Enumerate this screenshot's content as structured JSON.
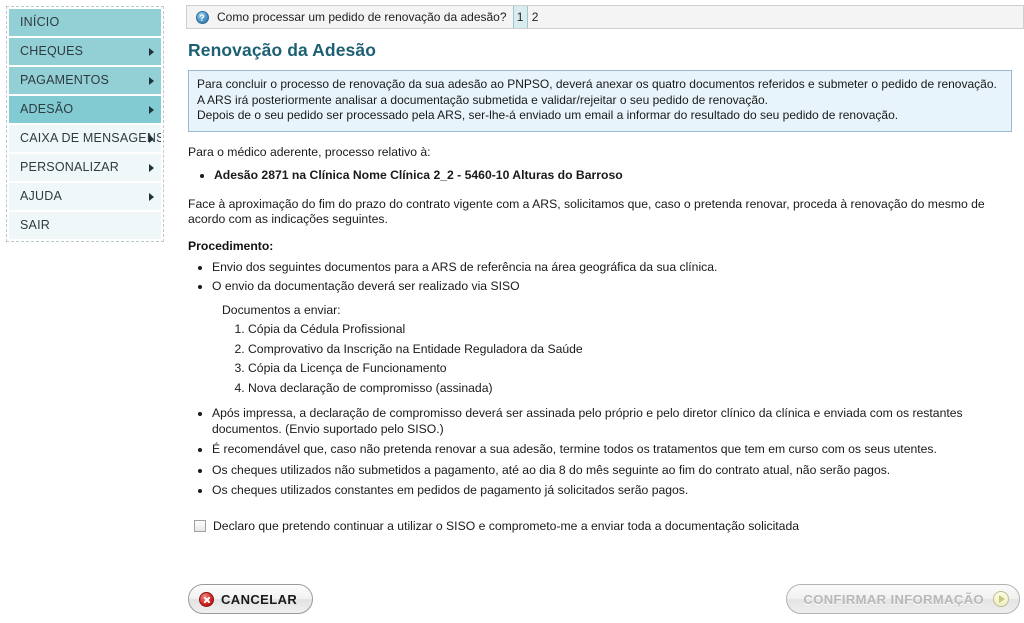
{
  "sidebar": {
    "items": [
      {
        "label": "INÍCIO",
        "has_arrow": false,
        "style": "teal"
      },
      {
        "label": "CHEQUES",
        "has_arrow": true,
        "style": "teal"
      },
      {
        "label": "PAGAMENTOS",
        "has_arrow": true,
        "style": "teal"
      },
      {
        "label": "ADESÃO",
        "has_arrow": true,
        "style": "teal-active"
      },
      {
        "label": "CAIXA DE MENSAGENS",
        "has_arrow": true,
        "style": "light"
      },
      {
        "label": "PERSONALIZAR",
        "has_arrow": true,
        "style": "light"
      },
      {
        "label": "AJUDA",
        "has_arrow": true,
        "style": "light"
      },
      {
        "label": "SAIR",
        "has_arrow": false,
        "style": "light"
      }
    ]
  },
  "help_bar": {
    "icon": "question-mark-icon",
    "icon_glyph": "?",
    "text": "Como processar um pedido de renovação da adesão?",
    "pages": [
      {
        "label": "1",
        "active": true
      },
      {
        "label": "2",
        "active": false
      }
    ]
  },
  "page": {
    "title": "Renovação da Adesão"
  },
  "info_box": {
    "lines": [
      "Para concluir o processo de renovação da sua adesão ao PNPSO, deverá anexar os quatro documentos referidos e submeter o pedido de renovação.",
      "A ARS irá posteriormente analisar a documentação submetida e validar/rejeitar o seu pedido de renovação.",
      "Depois de o seu pedido ser processado pela ARS, ser-lhe-á enviado um email a informar do resultado do seu pedido de renovação."
    ]
  },
  "content": {
    "intro": "Para o médico aderente, processo relativo à:",
    "adesao_item": "Adesão 2871 na Clínica Nome Clínica 2_2 - 5460-10 Alturas do Barroso",
    "paragraph": "Face à aproximação do fim do prazo do contrato vigente com a ARS, solicitamos que, caso o pretenda renovar, proceda à renovação do mesmo de acordo com as indicações seguintes.",
    "procedure_label": "Procedimento:",
    "procedure_bullets_top": [
      "Envio dos seguintes documentos para a ARS de referência na área geográfica da sua clínica.",
      "O envio da documentação deverá ser realizado via SISO"
    ],
    "documents_label": "Documentos a enviar:",
    "documents": [
      "Cópia da Cédula Profissional",
      "Comprovativo da Inscrição na Entidade Reguladora da Saúde",
      "Cópia da Licença de Funcionamento",
      "Nova declaração de compromisso (assinada)"
    ],
    "procedure_bullets_bottom": [
      "Após impressa, a declaração de compromisso deverá ser assinada pelo próprio e pelo diretor clínico da clínica e enviada com os restantes documentos. (Envio suportado pelo SISO.)",
      "É recomendável que, caso não pretenda renovar a sua adesão, termine todos os tratamentos que tem em curso com os seus utentes.",
      "Os cheques utilizados não submetidos a pagamento, até ao dia 8 do mês seguinte ao fim do contrato atual, não serão pagos.",
      "Os cheques utilizados constantes em pedidos de pagamento já solicitados serão pagos."
    ]
  },
  "declaration": {
    "checked": false,
    "label": "Declaro que pretendo continuar a utilizar o SISO e comprometo-me a enviar toda a documentação solicitada"
  },
  "buttons": {
    "cancel": {
      "label": "CANCELAR",
      "icon": "red-x-circle-icon",
      "enabled": true
    },
    "confirm": {
      "label": "CONFIRMAR INFORMAÇÃO",
      "icon": "play-arrow-circle-icon",
      "enabled": false
    }
  },
  "colors": {
    "sidebar_teal": "#93d0d6",
    "sidebar_teal_active": "#82cbd3",
    "sidebar_light": "#f0f7f9",
    "title": "#1c6073",
    "info_bg": "#e8f4fb",
    "info_border": "#9ab8cf",
    "cancel_icon": "#cf2020",
    "confirm_arrow": "#c8c879"
  }
}
